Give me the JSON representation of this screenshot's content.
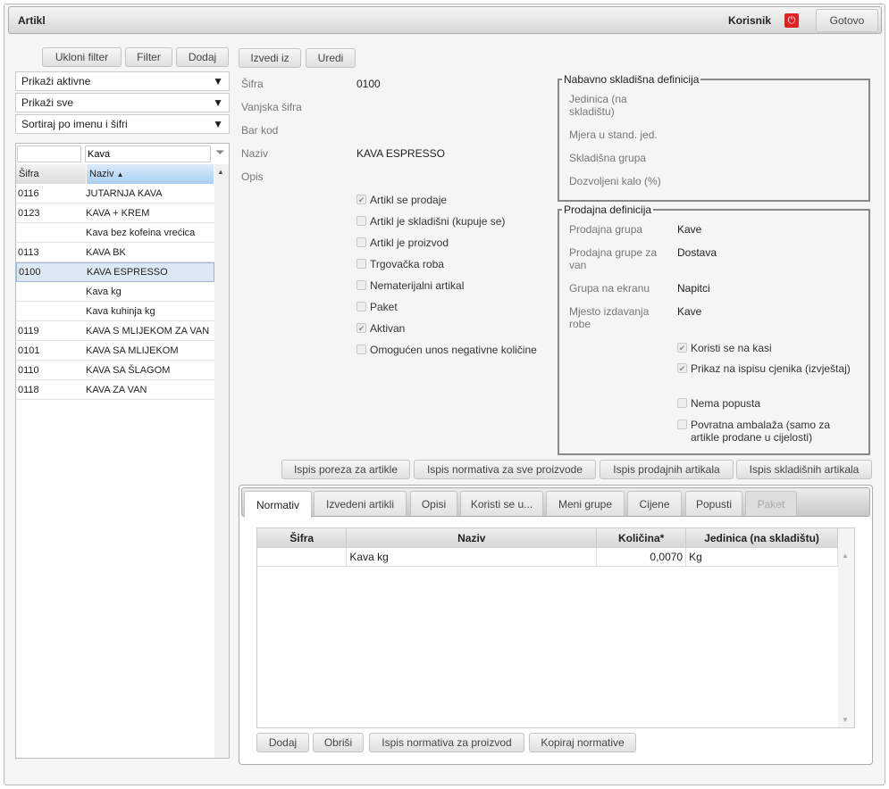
{
  "header": {
    "title": "Artikl",
    "user": "Korisnik",
    "done": "Gotovo"
  },
  "left": {
    "buttons": [
      "Ukloni filter",
      "Filter",
      "Dodaj"
    ],
    "selects": [
      "Prikaži aktivne",
      "Prikaži sve",
      "Sortiraj po imenu i šifri"
    ],
    "filter_code": "",
    "filter_name": "Kava",
    "columns": [
      "Šifra",
      "Naziv"
    ],
    "rows": [
      [
        "0116",
        "JUTARNJA KAVA"
      ],
      [
        "0123",
        "KAVA + KREM"
      ],
      [
        "",
        "Kava bez kofeina vrećica"
      ],
      [
        "0113",
        "KAVA BK"
      ],
      [
        "0100",
        "KAVA ESPRESSO"
      ],
      [
        "",
        "Kava kg"
      ],
      [
        "",
        "Kava kuhinja kg"
      ],
      [
        "0119",
        "KAVA S MLIJEKOM ZA VAN"
      ],
      [
        "0101",
        "KAVA SA MLIJEKOM"
      ],
      [
        "0110",
        "KAVA SA ŠLAGOM"
      ],
      [
        "0118",
        "KAVA ZA VAN"
      ]
    ],
    "selected": 4
  },
  "main": {
    "buttons": [
      "Izvedi iz",
      "Uredi"
    ],
    "fields": [
      {
        "label": "Šifra",
        "value": "0100"
      },
      {
        "label": "Vanjska šifra",
        "value": ""
      },
      {
        "label": "Bar kod",
        "value": ""
      },
      {
        "label": "Naziv",
        "value": "KAVA ESPRESSO"
      },
      {
        "label": "Opis",
        "value": ""
      }
    ],
    "checks": [
      {
        "label": "Artikl se prodaje",
        "checked": true
      },
      {
        "label": "Artikl je skladišni (kupuje se)",
        "checked": false
      },
      {
        "label": "Artikl je proizvod",
        "checked": false
      },
      {
        "label": "Trgovačka roba",
        "checked": false
      },
      {
        "label": "Nematerijalni artikal",
        "checked": false
      },
      {
        "label": "Paket",
        "checked": false
      },
      {
        "label": "Aktivan",
        "checked": true
      },
      {
        "label": "Omogućen unos negativne količine",
        "checked": false
      }
    ]
  },
  "storage": {
    "title": "Nabavno skladišna definicija",
    "labels": [
      "Jedinica (na skladištu)",
      "Mjera u stand. jed.",
      "Skladišna grupa",
      "Dozvoljeni kalo (%)"
    ]
  },
  "sales": {
    "title": "Prodajna definicija",
    "fields": [
      {
        "label": "Prodajna grupa",
        "value": "Kave"
      },
      {
        "label": "Prodajna grupe za van",
        "value": "Dostava"
      },
      {
        "label": "Grupa na ekranu",
        "value": "Napitci"
      },
      {
        "label": "Mjesto izdavanja robe",
        "value": "Kave"
      }
    ],
    "checks": [
      {
        "label": "Koristi se na kasi",
        "checked": true
      },
      {
        "label": "Prikaz na ispisu cjenika (izvještaj)",
        "checked": true
      },
      {
        "label": "Nema popusta",
        "checked": false
      },
      {
        "label": "Povratna ambalaža (samo za artikle prodane u cijelosti)",
        "checked": false
      }
    ]
  },
  "reports": [
    "Ispis poreza za artikle",
    "Ispis normativa za sve proizvode",
    "Ispis prodajnih artikala",
    "Ispis skladišnih artikala"
  ],
  "tabs": [
    "Normativ",
    "Izvedeni artikli",
    "Opisi",
    "Koristi se u...",
    "Meni grupe",
    "Cijene",
    "Popusti",
    "Paket"
  ],
  "normativ": {
    "columns": [
      "Šifra",
      "Naziv",
      "Količina*",
      "Jedinica (na skladištu)"
    ],
    "rows": [
      [
        "",
        "Kava kg",
        "0,0070",
        "Kg"
      ]
    ],
    "buttons": [
      "Dodaj",
      "Obriši",
      "Ispis normativa za proizvod",
      "Kopiraj normative"
    ]
  }
}
